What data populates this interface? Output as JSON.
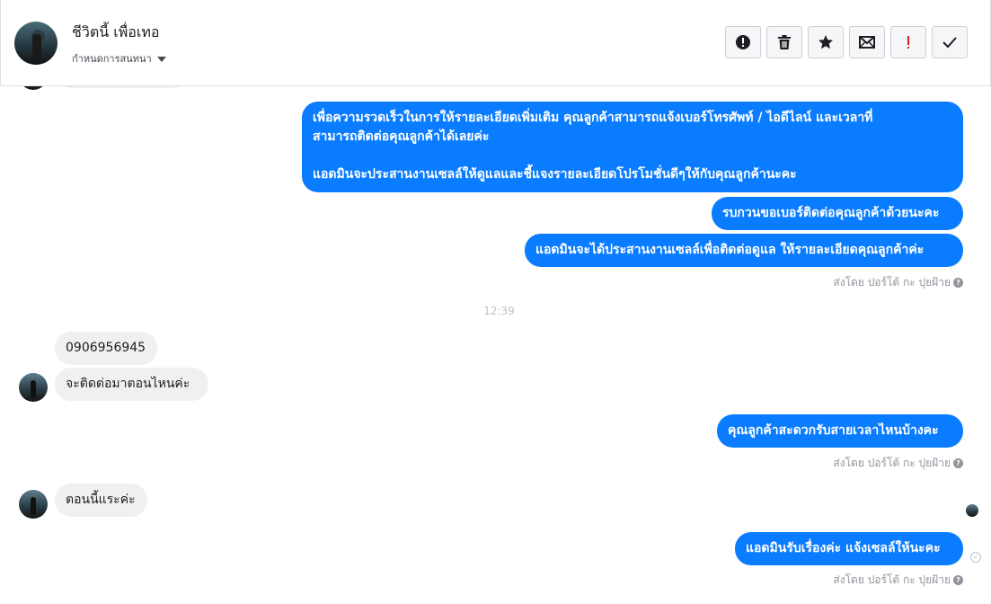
{
  "header": {
    "contact_name": "ชีวิตนี้ เพื่อเทอ",
    "conversation_settings": "กำหนดการสนทนา"
  },
  "toolbar": {
    "buttons": [
      {
        "name": "mark-spam",
        "icon": "exclamation-circle-icon"
      },
      {
        "name": "delete",
        "icon": "trash-icon"
      },
      {
        "name": "star",
        "icon": "star-icon"
      },
      {
        "name": "mark-unread",
        "icon": "envelope-icon"
      },
      {
        "name": "follow-up",
        "icon": "red-exclamation-icon"
      },
      {
        "name": "mark-done",
        "icon": "check-icon"
      }
    ]
  },
  "messages": {
    "out1_line1": "เพื่อความรวดเร็วในการให้รายละเอียดเพิ่มเติม คุณลูกค้าสามารถแจ้งเบอร์โทรศัพท์ / ไอดีไลน์ และเวลาที่",
    "out1_line2": "สามารถติดต่อคุณลูกค้าได้เลยค่ะ",
    "out1_line3": "แอดมินจะประสานงานเซลล์ให้ดูแลและชี้แจงรายละเอียดโปรโมชั่นดีๆให้กับคุณลูกค้านะคะ",
    "out2": "รบกวนขอเบอร์ติดต่อคุณลูกค้าด้วยนะคะ",
    "out3": "แอดมินจะได้ประสานงานเซลล์เพื่อติดต่อดูแล ให้รายละเอียดคุณลูกค้าค่ะ",
    "sent_by_1": "ส่งโดย ปอร์โต้ กะ ปุยฝ้าย",
    "time": "12:39",
    "in1": "0906956945",
    "in2": "จะติดต่อมาตอนไหนค่ะ",
    "out4": "คุณลูกค้าสะดวกรับสายเวลาไหนบ้างคะ",
    "sent_by_2": "ส่งโดย ปอร์โต้ กะ ปุยฝ้าย",
    "in3": "ตอนนี้แระค่ะ",
    "out5": "แอดมินรับเรื่องค่ะ แจ้งเซลล์ให้นะคะ",
    "sent_by_3": "ส่งโดย ปอร์โต้ กะ ปุยฝ้าย"
  },
  "colors": {
    "outgoing_bubble": "#0a7cff",
    "incoming_bubble": "#f1f0f0",
    "meta_text": "#90949c"
  }
}
